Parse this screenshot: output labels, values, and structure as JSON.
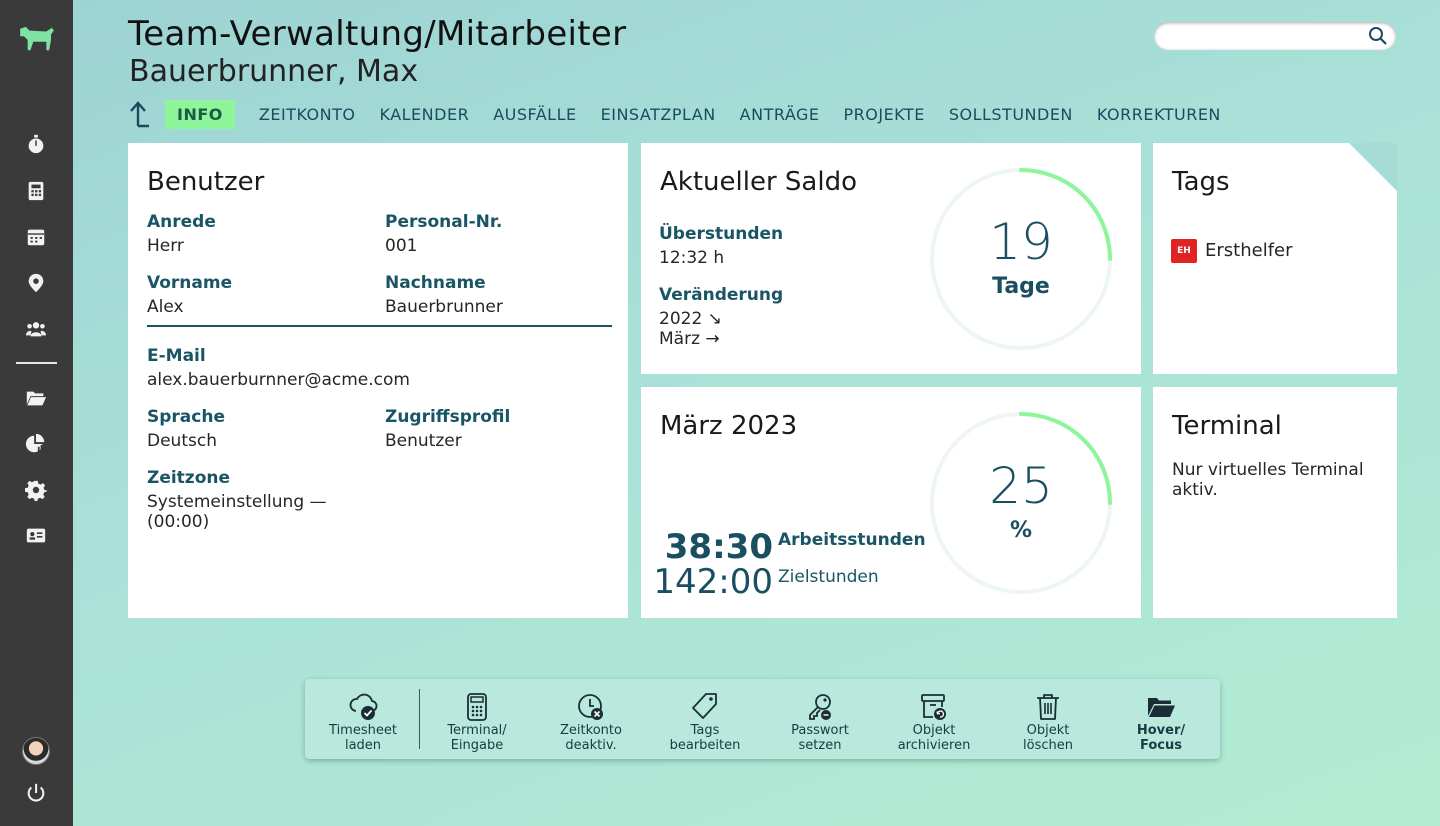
{
  "header": {
    "title": "Team-Verwaltung/Mitarbeiter",
    "subtitle": "Bauerbrunner, Max"
  },
  "search": {
    "placeholder": ""
  },
  "sidebar": {
    "items": [
      {
        "icon": "logo-dog-icon"
      },
      {
        "icon": "stopwatch-icon"
      },
      {
        "icon": "calculator-icon"
      },
      {
        "icon": "calendar-icon"
      },
      {
        "icon": "location-pin-icon"
      },
      {
        "icon": "team-icon"
      },
      {
        "icon": "folder-open-icon"
      },
      {
        "icon": "chart-pie-icon"
      },
      {
        "icon": "gear-icon"
      },
      {
        "icon": "id-card-icon"
      },
      {
        "icon": "avatar"
      },
      {
        "icon": "power-icon"
      }
    ]
  },
  "tabs": [
    {
      "label": "INFO",
      "active": true
    },
    {
      "label": "ZEITKONTO"
    },
    {
      "label": "KALENDER"
    },
    {
      "label": "AUSFÄLLE"
    },
    {
      "label": "EINSATZPLAN"
    },
    {
      "label": "ANTRÄGE"
    },
    {
      "label": "PROJEKTE"
    },
    {
      "label": "SOLLSTUNDEN"
    },
    {
      "label": "KORREKTUREN"
    }
  ],
  "benutzer": {
    "title": "Benutzer",
    "anrede_label": "Anrede",
    "anrede": "Herr",
    "personal_label": "Personal-Nr.",
    "personal": "001",
    "vorname_label": "Vorname",
    "vorname": "Alex",
    "nachname_label": "Nachname",
    "nachname": "Bauerbrunner",
    "email_label": "E-Mail",
    "email": "alex.bauerburnner@acme.com",
    "sprache_label": "Sprache",
    "sprache": "Deutsch",
    "zugriff_label": "Zugriffsprofil",
    "zugriff": "Benutzer",
    "zeitzone_label": "Zeitzone",
    "zeitzone_line1": "Systemeinstellung —",
    "zeitzone_line2": "(00:00)"
  },
  "saldo": {
    "title": "Aktueller Saldo",
    "ueber_label": "Überstunden",
    "ueber": "12:32 h",
    "veraenderung_label": "Veränderung",
    "v_line1": "2022 ↘",
    "v_line2": "März →",
    "ring_value": "19",
    "ring_unit": "Tage",
    "ring_progress": 0.25,
    "accent": "#8ef59a"
  },
  "tags": {
    "title": "Tags",
    "items": [
      {
        "badge": "EH",
        "label": "Ersthelfer",
        "color": "#e02424"
      }
    ]
  },
  "maerz": {
    "title": "März 2023",
    "arbeit_value": "38:30",
    "arbeit_label": "Arbeitsstunden",
    "ziel_value": "142:00",
    "ziel_label": "Zielstunden",
    "ring_value": "25",
    "ring_unit": "%",
    "ring_progress": 0.25
  },
  "terminal": {
    "title": "Terminal",
    "text_line1": "Nur virtuelles Terminal",
    "text_line2": "aktiv."
  },
  "actions": [
    {
      "line1": "Timesheet",
      "line2": "laden",
      "icon": "cloud-check-icon"
    },
    {
      "line1": "Terminal/",
      "line2": "Eingabe",
      "icon": "calculator-icon"
    },
    {
      "line1": "Zeitkonto",
      "line2": "deaktiv.",
      "icon": "clock-x-icon"
    },
    {
      "line1": "Tags",
      "line2": "bearbeiten",
      "icon": "tag-icon"
    },
    {
      "line1": "Passwort",
      "line2": "setzen",
      "icon": "key-icon"
    },
    {
      "line1": "Objekt",
      "line2": "archivieren",
      "icon": "archive-icon"
    },
    {
      "line1": "Objekt",
      "line2": "löschen",
      "icon": "trash-icon"
    },
    {
      "line1": "Hover/",
      "line2": "Focus",
      "icon": "folder-open-icon"
    }
  ]
}
